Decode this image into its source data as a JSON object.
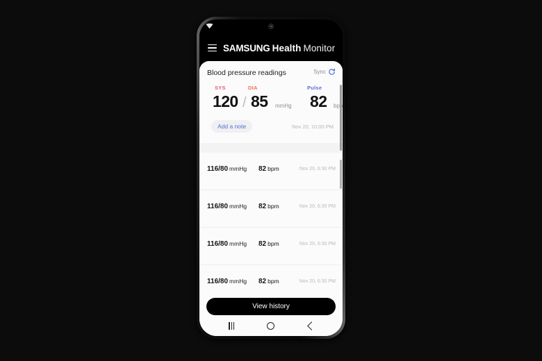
{
  "theme": {
    "sys_color": "#e8607d",
    "dia_color": "#ef6f4e",
    "pulse_color": "#5b6fd6",
    "accent_blue": "#4a72d4",
    "sheet_bg": "#fbfbfb",
    "frame_black": "#000000"
  },
  "status_bar": {
    "wifi_icon": "wifi-icon",
    "camera_icon": "front-camera-punch-hole"
  },
  "app_bar": {
    "menu_icon": "hamburger-menu-icon",
    "brand": "SAMSUNG",
    "title_mid": "Health",
    "title_light": "Monitor"
  },
  "sheet": {
    "title": "Blood pressure readings",
    "sync_label": "Sync",
    "sync_icon": "sync-refresh-icon"
  },
  "current_reading": {
    "sys_label": "SYS",
    "dia_label": "DIA",
    "pulse_label": "Pulse",
    "sys_value": "120",
    "separator": "/",
    "dia_value": "85",
    "bp_unit": "mmHg",
    "pulse_value": "82",
    "pulse_unit": "bpm",
    "add_note_label": "Add a note",
    "timestamp": "Nov 20, 10:00 PM"
  },
  "history": {
    "rows": [
      {
        "bp": "116/80",
        "bp_unit": "mmHg",
        "pulse": "82",
        "pulse_unit": "bpm",
        "time": "Nov 20, 6:30 PM"
      },
      {
        "bp": "116/80",
        "bp_unit": "mmHg",
        "pulse": "82",
        "pulse_unit": "bpm",
        "time": "Nov 20, 6:30 PM"
      },
      {
        "bp": "116/80",
        "bp_unit": "mmHg",
        "pulse": "82",
        "pulse_unit": "bpm",
        "time": "Nov 20, 6:30 PM"
      },
      {
        "bp": "116/80",
        "bp_unit": "mmHg",
        "pulse": "82",
        "pulse_unit": "bpm",
        "time": "Nov 20, 6:30 PM"
      }
    ]
  },
  "footer": {
    "view_history_label": "View history"
  },
  "nav_bar": {
    "recents_icon": "recents-icon",
    "home_icon": "home-icon",
    "back_icon": "back-icon"
  }
}
